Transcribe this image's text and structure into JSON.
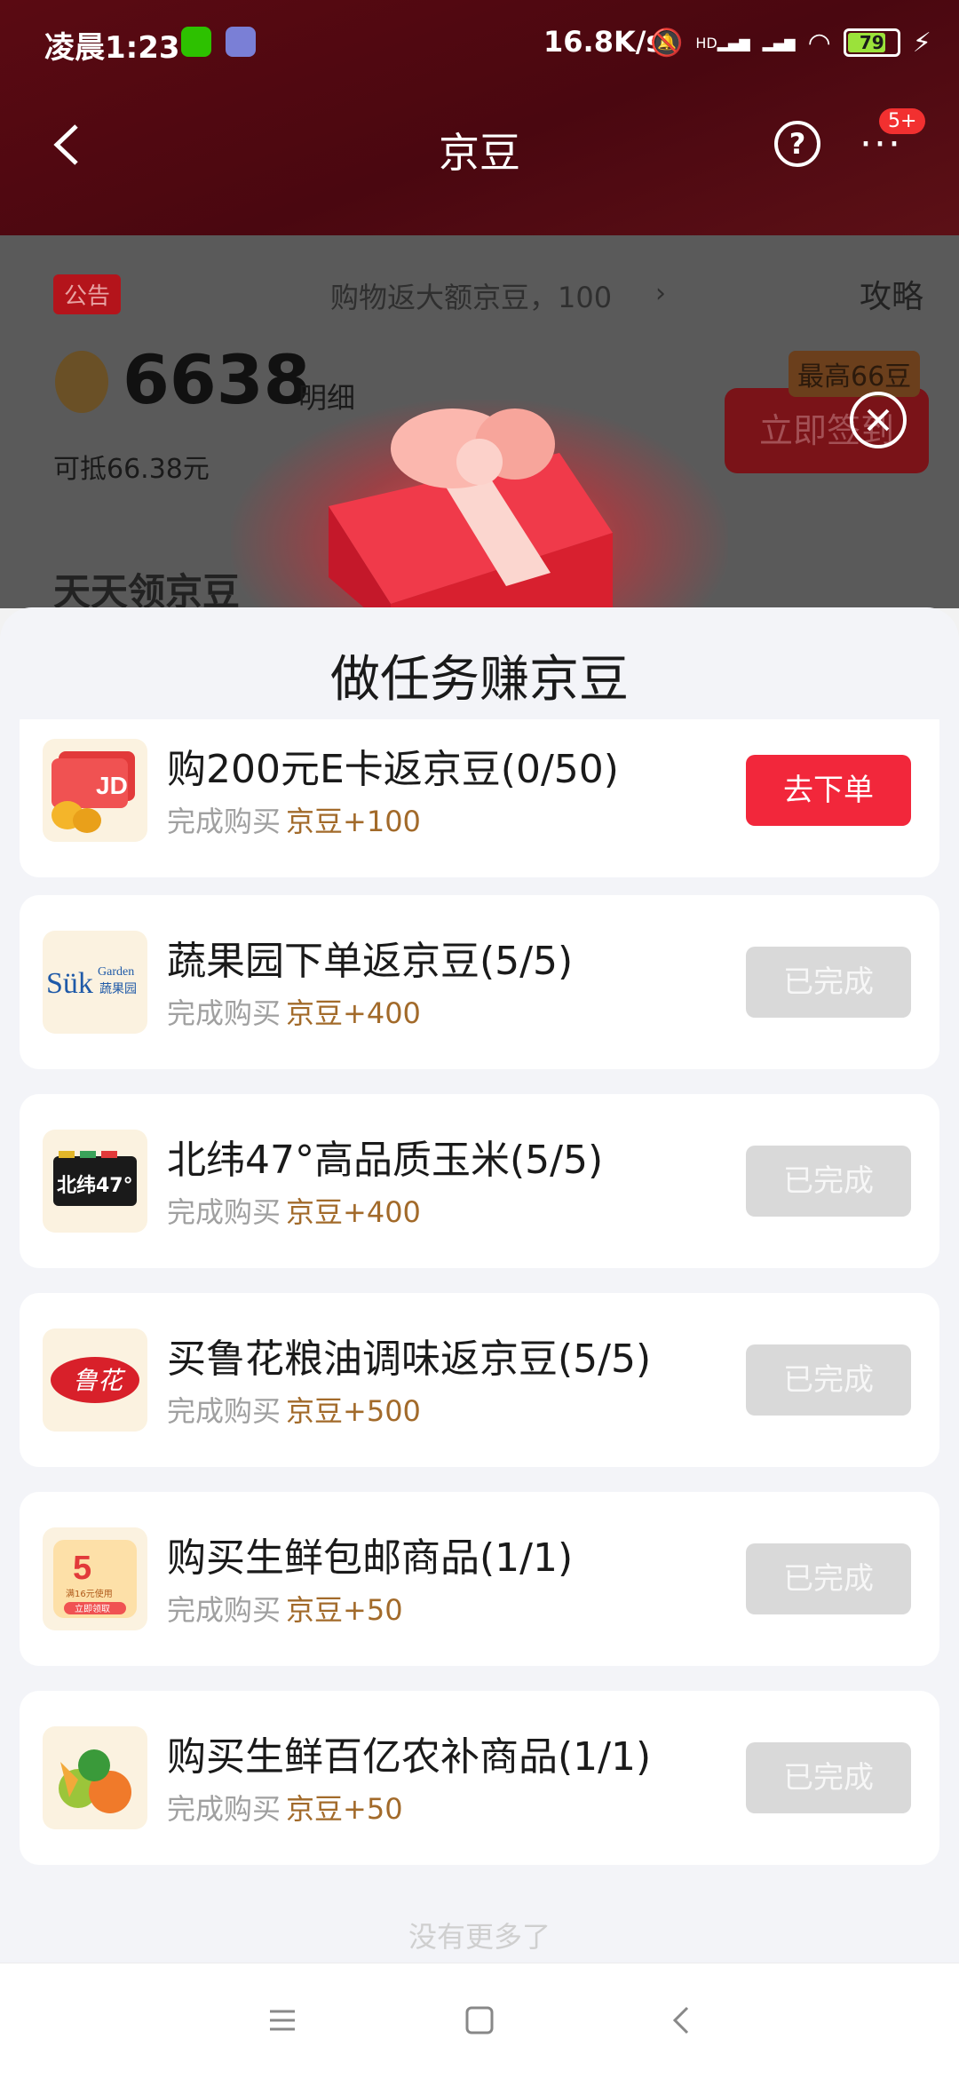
{
  "status_bar": {
    "time": "凌晨1:23",
    "network_speed": "16.8K/s",
    "signal_text": "HD",
    "battery": "79"
  },
  "header": {
    "title": "京豆",
    "more_badge": "5+"
  },
  "background": {
    "notice_tag": "公告",
    "notice_text": "购物返大额京豆，100",
    "strategy": "攻略",
    "beans": "6638",
    "detail_link": "明细",
    "offset": "可抵66.38元",
    "max_tag": "最高66豆",
    "signin_label": "立即签到",
    "daily_title": "天天领京豆"
  },
  "sheet": {
    "title": "做任务赚京豆",
    "sub_prefix": "完成购买",
    "tasks": [
      {
        "title": "购200元E卡返京豆(0/50)",
        "reward": "京豆+100",
        "action": "去下单",
        "state": "active",
        "logo": "jd-ecard-logo"
      },
      {
        "title": "蔬果园下单返京豆(5/5)",
        "reward": "京豆+400",
        "action": "已完成",
        "state": "done",
        "logo": "suk-garden-logo",
        "logo_text": "Sük",
        "logo_sub": "Garden",
        "logo_cn": "蔬果园"
      },
      {
        "title": "北纬47°高品质玉米(5/5)",
        "reward": "京豆+400",
        "action": "已完成",
        "state": "done",
        "logo": "beiwei47-logo",
        "logo_text": "北纬47°"
      },
      {
        "title": "买鲁花粮油调味返京豆(5/5)",
        "reward": "京豆+500",
        "action": "已完成",
        "state": "done",
        "logo": "luhua-logo",
        "logo_text": "鲁花"
      },
      {
        "title": "购买生鲜包邮商品(1/1)",
        "reward": "京豆+50",
        "action": "已完成",
        "state": "done",
        "logo": "coupon-logo",
        "logo_text": "5",
        "logo_sub": "满16元使用",
        "logo_cn": "立即领取"
      },
      {
        "title": "购买生鲜百亿农补商品(1/1)",
        "reward": "京豆+50",
        "action": "已完成",
        "state": "done",
        "logo": "vegetables-logo"
      }
    ],
    "footer_hint": "没有更多了"
  }
}
